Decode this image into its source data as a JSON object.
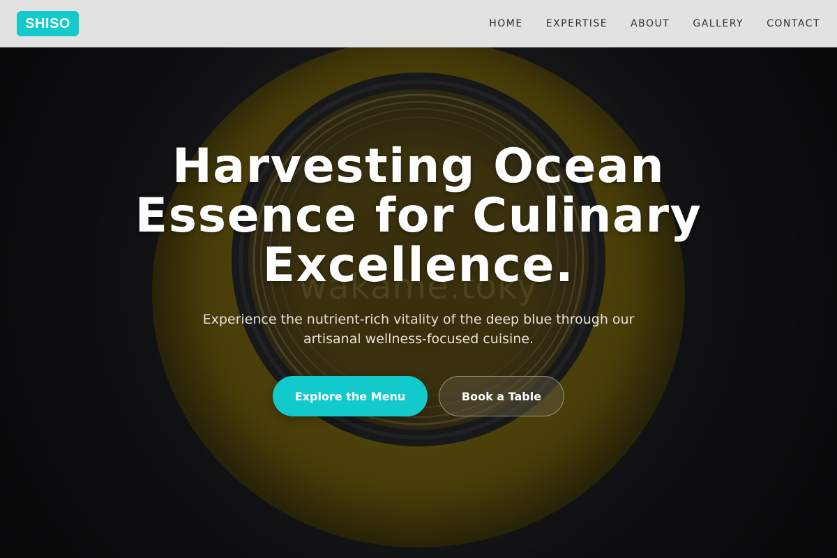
{
  "brand": {
    "logo_text": "SHISO",
    "accent_color": "#12c9cc"
  },
  "nav": {
    "items": [
      {
        "label": "HOME"
      },
      {
        "label": "EXPERTISE"
      },
      {
        "label": "ABOUT"
      },
      {
        "label": "GALLERY"
      },
      {
        "label": "CONTACT"
      }
    ]
  },
  "hero": {
    "title_lines": [
      "Harvesting Ocean",
      "Essence for Culinary",
      "Excellence."
    ],
    "subtitle_lines": [
      "Experience the nutrient-rich vitality of the deep blue through our",
      "artisanal wellness-focused cuisine."
    ],
    "primary_button": "Explore the Menu",
    "secondary_button": "Book a Table",
    "background_watermark": "wakame.toky"
  }
}
